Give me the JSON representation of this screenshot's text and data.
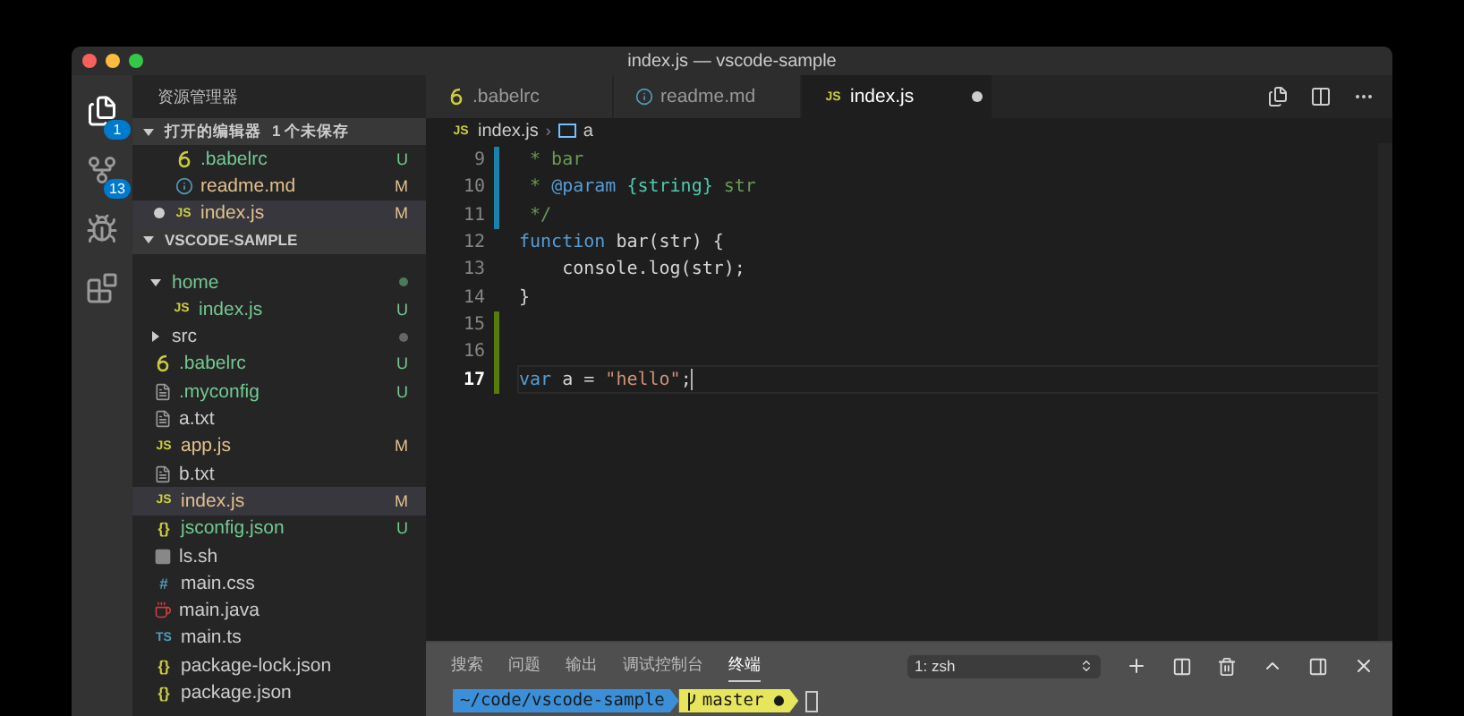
{
  "window": {
    "title": "index.js — vscode-sample"
  },
  "activity_bar": [
    {
      "kind": "files",
      "selected": true,
      "badge": "1"
    },
    {
      "kind": "source-control",
      "selected": false,
      "badge": "13"
    },
    {
      "kind": "debug",
      "selected": false
    },
    {
      "kind": "extensions",
      "selected": false
    }
  ],
  "sidebar": {
    "title": "资源管理器",
    "open_editors": {
      "title": "打开的编辑器",
      "note": "1 个未保存",
      "expanded": true,
      "items": [
        {
          "name": ".babelrc",
          "kind": "babel",
          "untracked": true,
          "modified": false,
          "badge": "U",
          "dirty": false,
          "selected": false
        },
        {
          "name": "readme.md",
          "kind": "info",
          "untracked": false,
          "modified": true,
          "badge": "M",
          "dirty": false,
          "selected": false
        },
        {
          "name": "index.js",
          "kind": "js",
          "glyph": "JS",
          "untracked": false,
          "modified": true,
          "badge": "M",
          "dirty": true,
          "selected": true
        }
      ]
    },
    "project": {
      "title": "VSCODE-SAMPLE",
      "expanded": true,
      "items": [
        {
          "name": "home",
          "kind": "folder",
          "untracked": true,
          "modified": false,
          "expanded": true,
          "has_changes": true,
          "selected": false,
          "children": [
            {
              "name": "index.js",
              "kind": "js",
              "glyph": "JS",
              "untracked": true,
              "modified": false,
              "badge": "U",
              "selected": false
            }
          ]
        },
        {
          "name": "src",
          "kind": "folder",
          "untracked": false,
          "modified": false,
          "expanded": false,
          "has_changes": true,
          "selected": false
        },
        {
          "name": ".babelrc",
          "kind": "babel",
          "untracked": true,
          "modified": false,
          "badge": "U",
          "selected": false
        },
        {
          "name": ".myconfig",
          "kind": "text",
          "untracked": true,
          "modified": false,
          "badge": "U",
          "selected": false
        },
        {
          "name": "a.txt",
          "kind": "text",
          "untracked": false,
          "modified": false,
          "selected": false
        },
        {
          "name": "app.js",
          "kind": "js",
          "glyph": "JS",
          "untracked": false,
          "modified": true,
          "badge": "M",
          "selected": false
        },
        {
          "name": "b.txt",
          "kind": "text",
          "untracked": false,
          "modified": false,
          "selected": false
        },
        {
          "name": "index.js",
          "kind": "js",
          "glyph": "JS",
          "untracked": false,
          "modified": true,
          "badge": "M",
          "selected": true
        },
        {
          "name": "jsconfig.json",
          "kind": "json",
          "glyph": "{}",
          "untracked": true,
          "modified": false,
          "badge": "U",
          "selected": false
        },
        {
          "name": "ls.sh",
          "kind": "shell",
          "untracked": false,
          "modified": false,
          "selected": false
        },
        {
          "name": "main.css",
          "kind": "css",
          "glyph": "#",
          "untracked": false,
          "modified": false,
          "selected": false
        },
        {
          "name": "main.java",
          "kind": "java",
          "untracked": false,
          "modified": false,
          "selected": false
        },
        {
          "name": "main.ts",
          "kind": "ts",
          "glyph": "TS",
          "untracked": false,
          "modified": false,
          "selected": false
        },
        {
          "name": "package-lock.json",
          "kind": "json",
          "glyph": "{}",
          "untracked": false,
          "modified": false,
          "selected": false
        },
        {
          "name": "package.json",
          "kind": "json",
          "glyph": "{}",
          "untracked": false,
          "modified": false,
          "selected": false
        }
      ]
    }
  },
  "editor": {
    "tabs": [
      {
        "name": ".babelrc",
        "kind": "babel",
        "selected": false,
        "dirty": false
      },
      {
        "name": "readme.md",
        "kind": "info",
        "selected": false,
        "dirty": false
      },
      {
        "name": "index.js",
        "kind": "js",
        "glyph": "JS",
        "selected": true,
        "dirty": true
      }
    ],
    "breadcrumb": {
      "file": "index.js",
      "glyph": "JS",
      "separator": "›",
      "symbol": "a"
    },
    "lines": [
      {
        "number": "9",
        "modified": true,
        "added": false,
        "active": false,
        "tokens": [
          {
            "kind": "comment",
            "text": " * bar"
          }
        ]
      },
      {
        "number": "10",
        "modified": true,
        "added": false,
        "active": false,
        "tokens": [
          {
            "kind": "comment",
            "text": " * "
          },
          {
            "kind": "doctag",
            "text": "@param"
          },
          {
            "kind": "type",
            "text": " {string}"
          },
          {
            "kind": "comment",
            "text": " str"
          }
        ]
      },
      {
        "number": "11",
        "modified": true,
        "added": false,
        "active": false,
        "tokens": [
          {
            "kind": "comment",
            "text": " */"
          }
        ]
      },
      {
        "number": "12",
        "modified": false,
        "added": false,
        "active": false,
        "tokens": [
          {
            "kind": "keyword",
            "text": "function"
          },
          {
            "kind": "plain",
            "text": " bar(str) {"
          }
        ]
      },
      {
        "number": "13",
        "modified": false,
        "added": false,
        "active": false,
        "tokens": [
          {
            "kind": "plain",
            "text": "    console.log(str);"
          }
        ]
      },
      {
        "number": "14",
        "modified": false,
        "added": false,
        "active": false,
        "tokens": [
          {
            "kind": "plain",
            "text": "}"
          }
        ]
      },
      {
        "number": "15",
        "modified": false,
        "added": true,
        "active": false
      },
      {
        "number": "16",
        "modified": false,
        "added": true,
        "active": false
      },
      {
        "number": "17",
        "modified": false,
        "added": true,
        "active": true,
        "tokens": [
          {
            "kind": "keyword",
            "text": "var"
          },
          {
            "kind": "plain",
            "text": " a = "
          },
          {
            "kind": "string",
            "text": "\"hello\""
          },
          {
            "kind": "plain",
            "text": ";"
          }
        ]
      }
    ]
  },
  "panel": {
    "tabs": [
      {
        "label": "搜索",
        "selected": false
      },
      {
        "label": "问题",
        "selected": false
      },
      {
        "label": "输出",
        "selected": false
      },
      {
        "label": "调试控制台",
        "selected": false
      },
      {
        "label": "终端",
        "selected": true
      }
    ],
    "terminal_select": "1: zsh",
    "prompt": {
      "path": "~/code/vscode-sample",
      "branch": "master ●"
    }
  }
}
